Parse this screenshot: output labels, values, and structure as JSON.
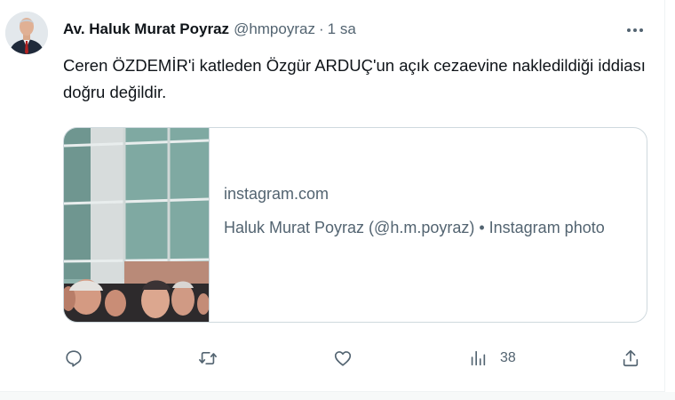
{
  "tweet": {
    "display_name": "Av. Haluk Murat Poyraz",
    "handle": "@hmpoyraz",
    "separator": "·",
    "time": "1 sa",
    "more_label": "•••",
    "text": "Ceren ÖZDEMİR'i katleden Özgür ARDUÇ'un açık cezaevine nakledildiği iddiası doğru değildir."
  },
  "card": {
    "domain": "instagram.com",
    "title": "Haluk Murat Poyraz (@h.m.poyraz) • Instagram photo"
  },
  "actions": {
    "reply_icon": "reply-icon",
    "retweet_icon": "retweet-icon",
    "like_icon": "heart-icon",
    "views_icon": "views-icon",
    "views_count": "38",
    "share_icon": "share-icon"
  },
  "colors": {
    "text_primary": "#0f1419",
    "text_secondary": "#536471",
    "border": "#cfd9de"
  }
}
